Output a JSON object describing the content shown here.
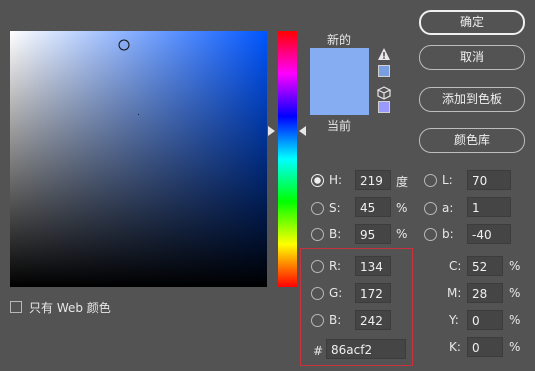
{
  "swatch": {
    "new_label": "新的",
    "current_label": "当前",
    "new_color": "#86acf2",
    "current_color": "#86acf2",
    "gamut_swatch_color": "#7a9fe0",
    "web_swatch_color": "#9999ff"
  },
  "buttons": {
    "ok": "确定",
    "cancel": "取消",
    "add_to_swatches": "添加到色板",
    "color_libraries": "颜色库"
  },
  "hsb": {
    "h_label": "H:",
    "h_value": "219",
    "h_unit": "度",
    "s_label": "S:",
    "s_value": "45",
    "s_unit": "%",
    "b_label": "B:",
    "b_value": "95",
    "b_unit": "%"
  },
  "lab": {
    "l_label": "L:",
    "l_value": "70",
    "a_label": "a:",
    "a_value": "1",
    "b_label": "b:",
    "b_value": "-40"
  },
  "rgb": {
    "r_label": "R:",
    "r_value": "134",
    "g_label": "G:",
    "g_value": "172",
    "b_label": "B:",
    "b_value": "242"
  },
  "cmyk": {
    "c_label": "C:",
    "c_value": "52",
    "c_unit": "%",
    "m_label": "M:",
    "m_value": "28",
    "m_unit": "%",
    "y_label": "Y:",
    "y_value": "0",
    "y_unit": "%",
    "k_label": "K:",
    "k_value": "0",
    "k_unit": "%"
  },
  "hex": {
    "label": "#",
    "value": "86acf2"
  },
  "web_only": {
    "label": "只有 Web 颜色",
    "checked": false
  },
  "accent": {
    "highlight_border": "#c8323c"
  }
}
